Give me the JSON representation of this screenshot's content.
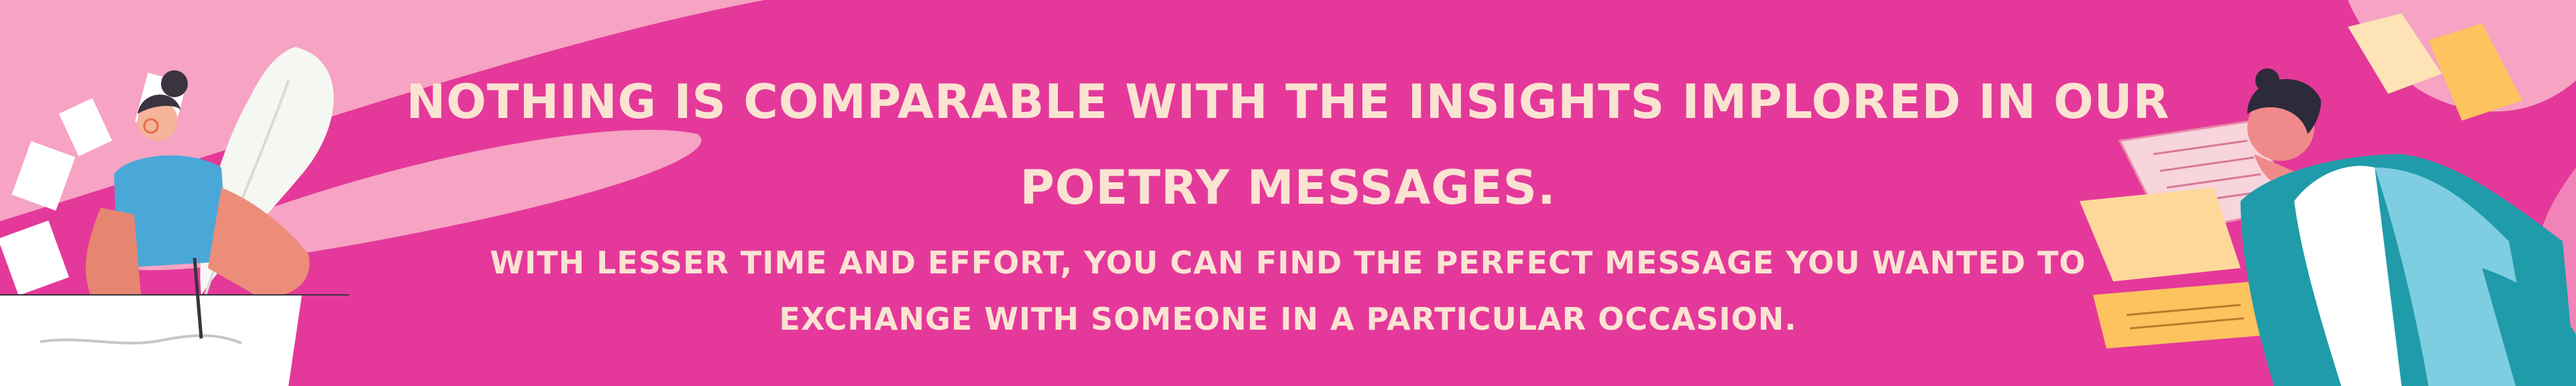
{
  "banner": {
    "headline": "NOTHING IS COMPARABLE WITH THE INSIGHTS IMPLORED IN OUR POETRY MESSAGES.",
    "subline": "WITH LESSER TIME AND EFFORT, YOU CAN FIND THE PERFECT MESSAGE YOU WANTED TO EXCHANGE WITH SOMEONE IN A PARTICULAR OCCASION."
  },
  "colors": {
    "background": "#e4399a",
    "swoosh": "#f6a3c4",
    "text": "#fbe3d2",
    "paper_yellow": "#fdd89a",
    "paper_orange": "#fcc35e",
    "shirt_teal": "#1f9ba9",
    "shirt_blue": "#4aa8d8"
  },
  "illustrations": {
    "left": "woman-writing-with-quill-icon",
    "right": "man-with-flying-papers-icon"
  }
}
